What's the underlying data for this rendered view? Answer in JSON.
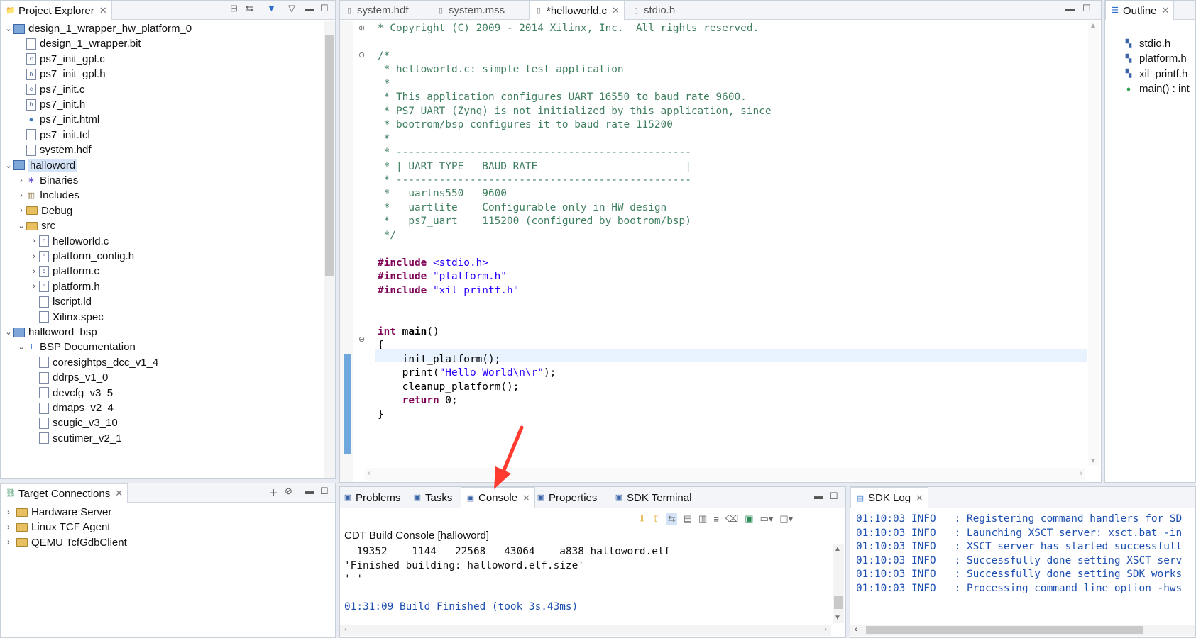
{
  "project_explorer": {
    "title": "Project Explorer",
    "items": [
      {
        "label": "design_1_wrapper_hw_platform_0",
        "kind": "project",
        "expand": "down"
      },
      {
        "label": "design_1_wrapper.bit",
        "kind": "file",
        "expand": ""
      },
      {
        "label": "ps7_init_gpl.c",
        "kind": "c",
        "expand": ""
      },
      {
        "label": "ps7_init_gpl.h",
        "kind": "h",
        "expand": ""
      },
      {
        "label": "ps7_init.c",
        "kind": "c",
        "expand": ""
      },
      {
        "label": "ps7_init.h",
        "kind": "h",
        "expand": ""
      },
      {
        "label": "ps7_init.html",
        "kind": "html",
        "expand": ""
      },
      {
        "label": "ps7_init.tcl",
        "kind": "file",
        "expand": ""
      },
      {
        "label": "system.hdf",
        "kind": "file",
        "expand": ""
      },
      {
        "label": "halloword",
        "kind": "project",
        "expand": "down"
      },
      {
        "label": "Binaries",
        "kind": "bin",
        "expand": "right"
      },
      {
        "label": "Includes",
        "kind": "inc",
        "expand": "right"
      },
      {
        "label": "Debug",
        "kind": "folder",
        "expand": "right"
      },
      {
        "label": "src",
        "kind": "folder",
        "expand": "down"
      },
      {
        "label": "helloworld.c",
        "kind": "c",
        "expand": "right"
      },
      {
        "label": "platform_config.h",
        "kind": "h",
        "expand": "right"
      },
      {
        "label": "platform.c",
        "kind": "c",
        "expand": "right"
      },
      {
        "label": "platform.h",
        "kind": "h",
        "expand": "right"
      },
      {
        "label": "lscript.ld",
        "kind": "ld",
        "expand": ""
      },
      {
        "label": "Xilinx.spec",
        "kind": "file",
        "expand": ""
      },
      {
        "label": "halloword_bsp",
        "kind": "bsp",
        "expand": "down"
      },
      {
        "label": "BSP Documentation",
        "kind": "info",
        "expand": "down"
      },
      {
        "label": "coresightps_dcc_v1_4",
        "kind": "file",
        "expand": ""
      },
      {
        "label": "ddrps_v1_0",
        "kind": "file",
        "expand": ""
      },
      {
        "label": "devcfg_v3_5",
        "kind": "file",
        "expand": ""
      },
      {
        "label": "dmaps_v2_4",
        "kind": "file",
        "expand": ""
      },
      {
        "label": "scugic_v3_10",
        "kind": "file",
        "expand": ""
      },
      {
        "label": "scutimer_v2_1",
        "kind": "file",
        "expand": ""
      }
    ]
  },
  "target_connections": {
    "title": "Target Connections",
    "items": [
      "Hardware Server",
      "Linux TCF Agent",
      "QEMU TcfGdbClient"
    ]
  },
  "editor": {
    "tabs": [
      "system.hdf",
      "system.mss",
      "*helloworld.c",
      "stdio.h"
    ],
    "lines": [
      {
        "t": "* Copyright (C) 2009 - 2014 Xilinx, Inc.  All rights reserved.",
        "s": "c"
      },
      {
        "t": "",
        "s": "c"
      },
      {
        "t": "/*",
        "s": "c"
      },
      {
        "t": " * helloworld.c: simple test application",
        "s": "c"
      },
      {
        "t": " *",
        "s": "c"
      },
      {
        "t": " * This application configures UART 16550 to baud rate 9600.",
        "s": "c"
      },
      {
        "t": " * PS7 UART (Zynq) is not initialized by this application, since",
        "s": "c"
      },
      {
        "t": " * bootrom/bsp configures it to baud rate 115200",
        "s": "c"
      },
      {
        "t": " *",
        "s": "c"
      },
      {
        "t": " * ------------------------------------------------",
        "s": "c"
      },
      {
        "t": " * | UART TYPE   BAUD RATE                        |",
        "s": "c"
      },
      {
        "t": " * ------------------------------------------------",
        "s": "c"
      },
      {
        "t": " *   uartns550   9600",
        "s": "c"
      },
      {
        "t": " *   uartlite    Configurable only in HW design",
        "s": "c"
      },
      {
        "t": " *   ps7_uart    115200 (configured by bootrom/bsp)",
        "s": "c"
      },
      {
        "t": " */",
        "s": "c"
      },
      {
        "t": "",
        "s": "c"
      },
      {
        "t": "#include <stdio.h>",
        "s": "inc"
      },
      {
        "t": "#include \"platform.h\"",
        "s": "inc"
      },
      {
        "t": "#include \"xil_printf.h\"",
        "s": "inc"
      },
      {
        "t": "",
        "s": "c"
      },
      {
        "t": "",
        "s": "c"
      },
      {
        "t": "int main()",
        "s": "main"
      },
      {
        "t": "{",
        "s": "k"
      },
      {
        "t": "    init_platform();",
        "s": "k"
      },
      {
        "t": "    print(\"Hello World\\n\\r\");",
        "s": "print"
      },
      {
        "t": "    cleanup_platform();",
        "s": "k"
      },
      {
        "t": "    return 0;",
        "s": "ret"
      },
      {
        "t": "}",
        "s": "k"
      }
    ]
  },
  "outline": {
    "title": "Outline",
    "items": [
      "stdio.h",
      "platform.h",
      "xil_printf.h",
      "main() : int"
    ]
  },
  "console": {
    "tabs": [
      "Problems",
      "Tasks",
      "Console",
      "Properties",
      "SDK Terminal"
    ],
    "header": "CDT Build Console [halloword]",
    "lines": [
      "  19352    1144   22568   43064    a838 halloword.elf",
      "'Finished building: halloword.elf.size'",
      "' '",
      "",
      "01:31:09 Build Finished (took 3s.43ms)"
    ]
  },
  "sdk_log": {
    "title": "SDK Log",
    "lines": [
      "01:10:03 INFO   : Registering command handlers for SD",
      "01:10:03 INFO   : Launching XSCT server: xsct.bat -in",
      "01:10:03 INFO   : XSCT server has started successfull",
      "01:10:03 INFO   : Successfully done setting XSCT serv",
      "01:10:03 INFO   : Successfully done setting SDK works",
      "01:10:03 INFO   : Processing command line option -hws"
    ]
  },
  "colors": {
    "accent": "#ff3b30",
    "selection": "#d4e3f7",
    "keyword": "#7f0055",
    "string": "#2a00ff",
    "comment": "#3f7f5f"
  }
}
